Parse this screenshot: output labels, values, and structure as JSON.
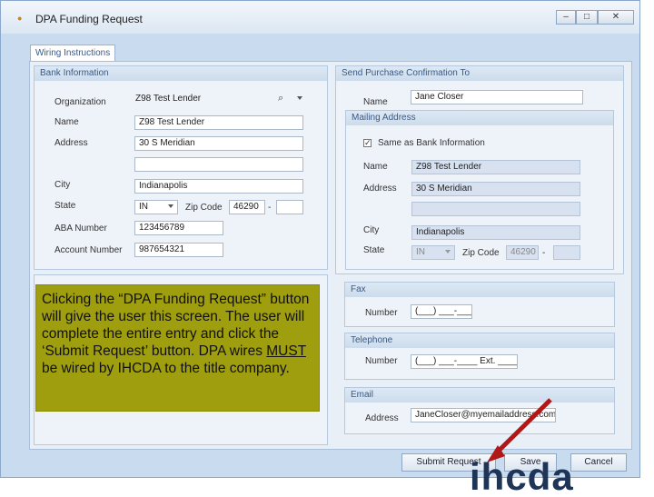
{
  "window": {
    "title": "DPA Funding Request",
    "minimize": "–",
    "maximize": "□",
    "close": "✕"
  },
  "tab": {
    "label": "Wiring Instructions"
  },
  "bank": {
    "heading": "Bank Information",
    "organization_label": "Organization",
    "organization": "Z98 Test Lender",
    "name_label": "Name",
    "name": "Z98 Test Lender",
    "address_label": "Address",
    "address1": "30 S Meridian",
    "address2": "",
    "city_label": "City",
    "city": "Indianapolis",
    "state_label": "State",
    "state": "IN",
    "zip_label": "Zip Code",
    "zip": "46290",
    "zip_ext": "",
    "zip_sep": "-",
    "aba_label": "ABA Number",
    "aba": "123456789",
    "account_label": "Account Number",
    "account": "987654321"
  },
  "confirmation": {
    "heading": "Send Purchase Confirmation To",
    "name_label": "Name",
    "name": "Jane Closer",
    "mailing_heading": "Mailing Address",
    "same_as_bank": "Same as Bank Information",
    "m_name_label": "Name",
    "m_name": "Z98 Test Lender",
    "m_address_label": "Address",
    "m_address1": "30 S Meridian",
    "m_address2": "",
    "m_city_label": "City",
    "m_city": "Indianapolis",
    "m_state_label": "State",
    "m_state": "IN",
    "m_zip_label": "Zip Code",
    "m_zip": "46290",
    "m_zip_ext": "",
    "m_zip_sep": "-",
    "fax_heading": "Fax",
    "fax_number_label": "Number",
    "fax_number": "(___) ___-____",
    "tel_heading": "Telephone",
    "tel_number_label": "Number",
    "tel_number": "(___) ___-____ Ext. _____",
    "email_heading": "Email",
    "email_address_label": "Address",
    "email_address": "JaneCloser@myemailaddress.com"
  },
  "overlay": {
    "text_before": "Clicking the “DPA Funding Request” button will give the user this screen. The user will complete the entire entry and click the ‘Submit Request’ button. DPA wires ",
    "emphasis": "MUST",
    "text_after": " be wired by IHCDA to the title company."
  },
  "buttons": {
    "submit": "Submit Request",
    "save": "Save",
    "cancel": "Cancel"
  },
  "colors": {
    "overlay": "#9f9e0e",
    "arrow": "#e02020"
  }
}
